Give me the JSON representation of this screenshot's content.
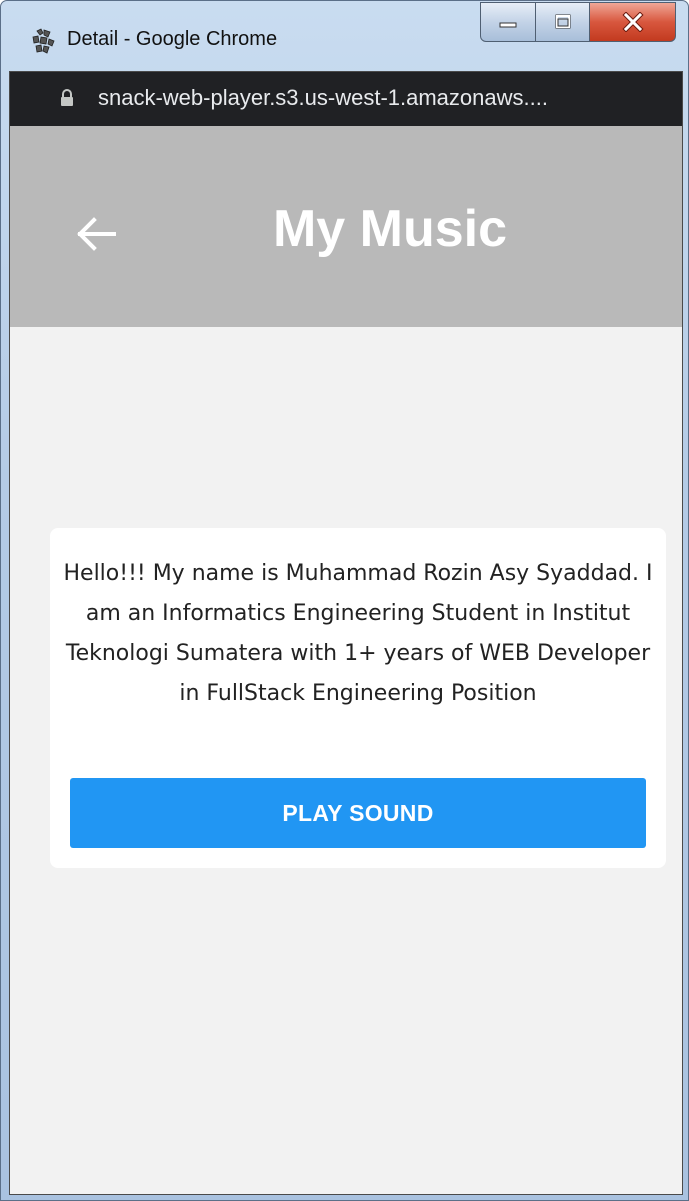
{
  "window": {
    "title": "Detail - Google Chrome",
    "controls": {
      "minimize_icon": "minimize-icon",
      "maximize_icon": "maximize-icon",
      "close_icon": "close-icon"
    }
  },
  "browser": {
    "url": "snack-web-player.s3.us-west-1.amazonaws....",
    "secure_icon": "lock-icon"
  },
  "header": {
    "title": "My Music",
    "back_icon": "arrow-left-icon",
    "background_color": "#b9b9b9"
  },
  "content": {
    "bio": "Hello!!! My name is Muhammad Rozin Asy Syaddad. I am an Informatics Engineering Student in Institut Teknologi Sumatera with 1+ years of WEB Developer in FullStack Engineering Position",
    "play_button_label": "PLAY SOUND",
    "play_button_color": "#2196f3"
  }
}
